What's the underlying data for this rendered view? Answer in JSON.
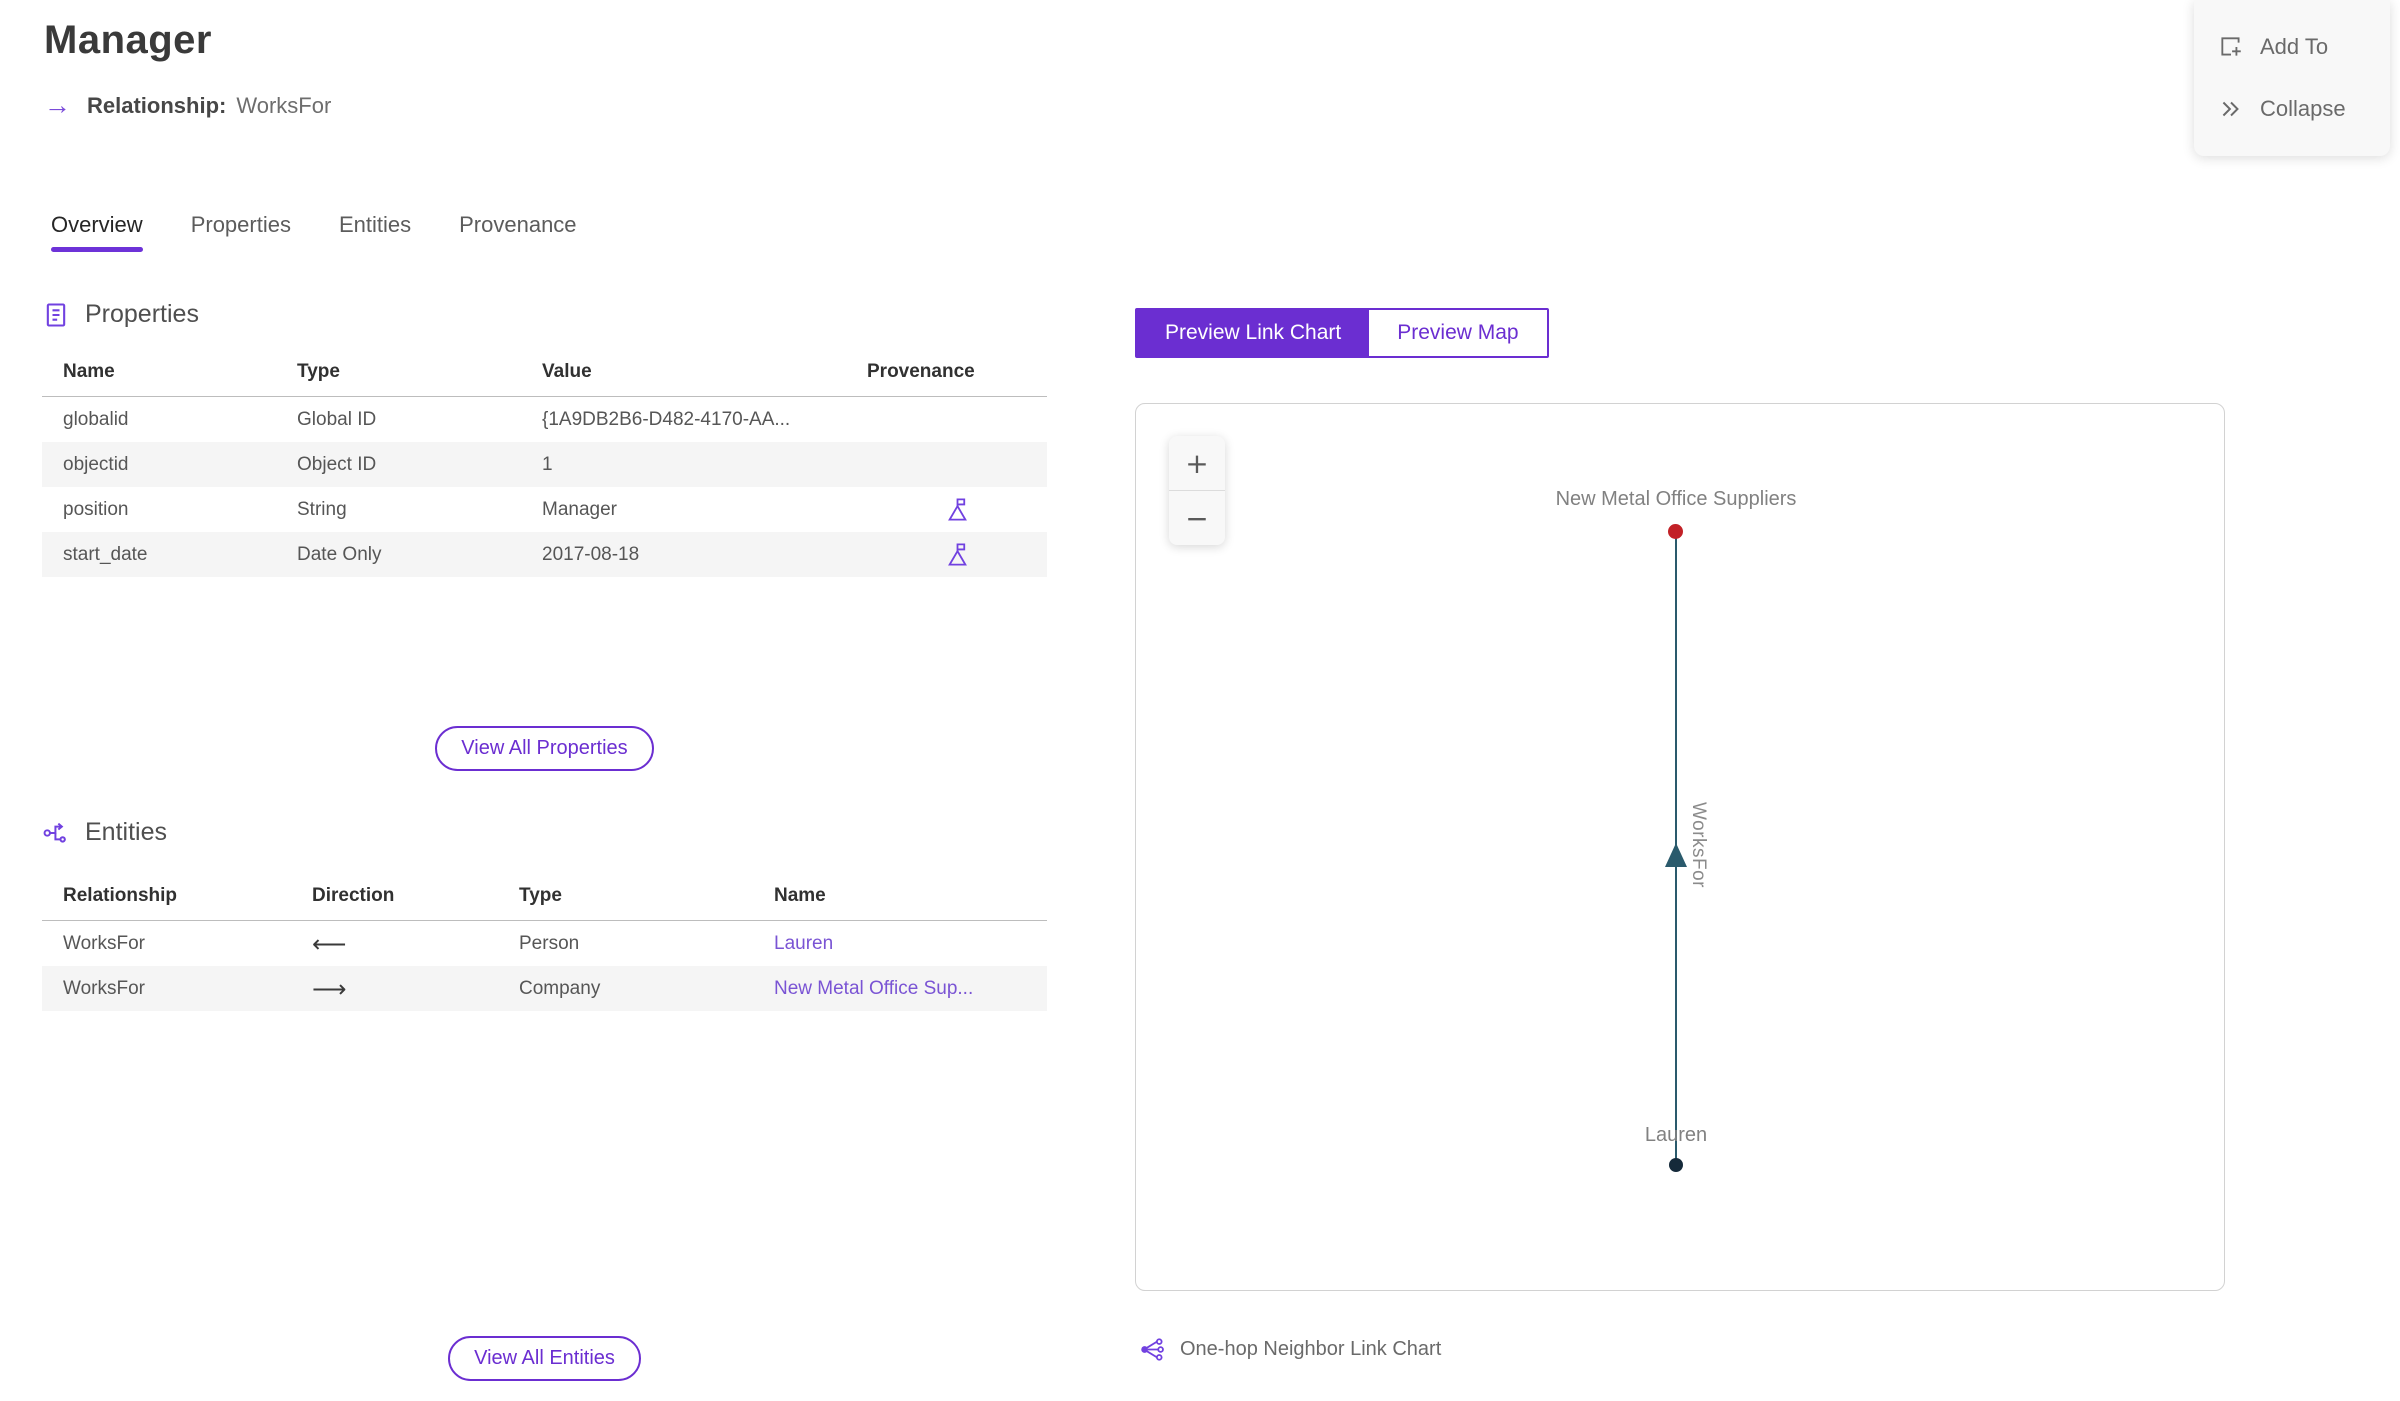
{
  "page": {
    "title": "Manager",
    "subtitle_label": "Relationship:",
    "subtitle_value": "WorksFor"
  },
  "icons": {
    "right_arrow": "→"
  },
  "actions": {
    "add_to": "Add To",
    "collapse": "Collapse"
  },
  "tabs": [
    {
      "label": "Overview",
      "active": true
    },
    {
      "label": "Properties",
      "active": false
    },
    {
      "label": "Entities",
      "active": false
    },
    {
      "label": "Provenance",
      "active": false
    }
  ],
  "properties_section": {
    "title": "Properties",
    "columns": [
      "Name",
      "Type",
      "Value",
      "Provenance"
    ],
    "rows": [
      {
        "name": "globalid",
        "type": "Global ID",
        "value": "{1A9DB2B6-D482-4170-AA...",
        "has_provenance": false
      },
      {
        "name": "objectid",
        "type": "Object ID",
        "value": "1",
        "has_provenance": false
      },
      {
        "name": "position",
        "type": "String",
        "value": "Manager",
        "has_provenance": true
      },
      {
        "name": "start_date",
        "type": "Date Only",
        "value": "2017-08-18",
        "has_provenance": true
      }
    ],
    "view_all_label": "View All Properties"
  },
  "entities_section": {
    "title": "Entities",
    "columns": [
      "Relationship",
      "Direction",
      "Type",
      "Name"
    ],
    "rows": [
      {
        "relationship": "WorksFor",
        "direction": "incoming",
        "direction_glyph": "⟵",
        "type": "Person",
        "name": "Lauren"
      },
      {
        "relationship": "WorksFor",
        "direction": "outgoing",
        "direction_glyph": "⟶",
        "type": "Company",
        "name": "New Metal Office Sup..."
      }
    ],
    "view_all_label": "View All Entities"
  },
  "preview": {
    "toggle": [
      {
        "label": "Preview Link Chart",
        "active": true
      },
      {
        "label": "Preview Map",
        "active": false
      }
    ],
    "zoom_in": "+",
    "zoom_out": "−",
    "caption": "One-hop Neighbor Link Chart",
    "link_chart": {
      "type": "link-chart",
      "nodes": [
        {
          "label": "New Metal Office Suppliers",
          "role": "target",
          "color": "#c22127",
          "position": "top"
        },
        {
          "label": "Lauren",
          "role": "source",
          "color": "#152a3a",
          "position": "bottom"
        }
      ],
      "edge": {
        "label": "WorksFor",
        "color": "#2a5a6c",
        "direction": "up"
      }
    }
  },
  "colors": {
    "accent_purple": "#6b2ed1",
    "link_purple": "#7a54d4",
    "tab_underline": "#6d32d8",
    "edge_teal": "#2a5a6c",
    "node_red": "#c22127",
    "node_navy": "#152a3a",
    "row_stripe": "#f5f5f5"
  }
}
